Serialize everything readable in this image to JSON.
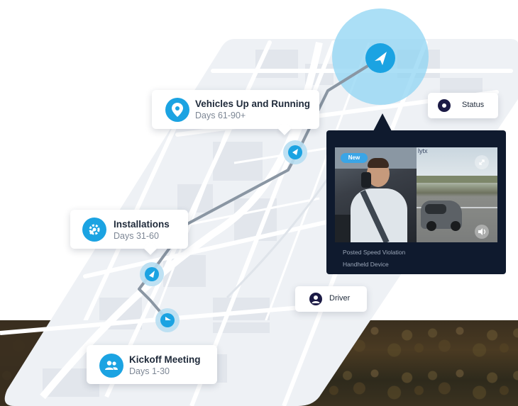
{
  "milestones": [
    {
      "title": "Vehicles Up and Running",
      "subtitle": "Days 61-90+",
      "icon": "location-pin-icon"
    },
    {
      "title": "Installations",
      "subtitle": "Days 31-60",
      "icon": "gear-wrench-icon"
    },
    {
      "title": "Kickoff Meeting",
      "subtitle": "Days 1-30",
      "icon": "people-icon"
    }
  ],
  "status_chip": {
    "label": "Status",
    "icon": "status-dot-icon"
  },
  "driver_chip": {
    "label": "Driver",
    "icon": "user-icon"
  },
  "video": {
    "badge": "New",
    "brand": "lytx",
    "event_line1": "Posted Speed Violation",
    "event_line2": "Handheld Device"
  },
  "colors": {
    "accent": "#1ba3e2",
    "route": "#8a96a3",
    "panel": "#0f1a2e",
    "halo": "#8fd4f3"
  }
}
